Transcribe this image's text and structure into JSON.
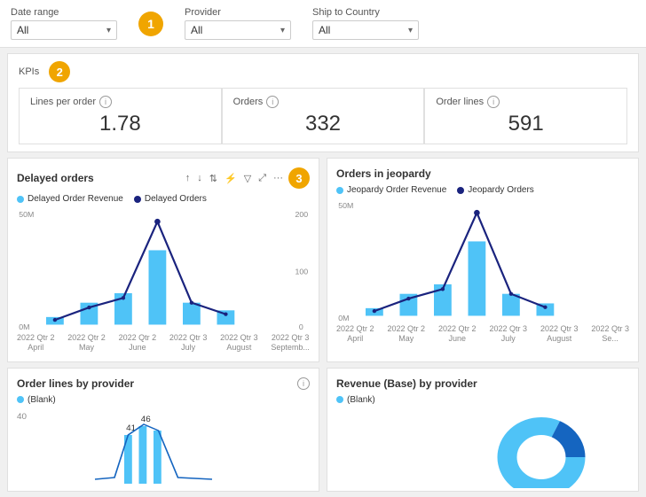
{
  "filters": {
    "date_range": {
      "label": "Date range",
      "value": "All"
    },
    "provider": {
      "label": "Provider",
      "value": "All"
    },
    "ship_to_country": {
      "label": "Ship to Country",
      "value": "All"
    }
  },
  "badges": {
    "badge1": "1",
    "badge2": "2",
    "badge3": "3"
  },
  "kpis": {
    "section_label": "KPIs",
    "cards": [
      {
        "title": "Lines per order",
        "value": "1.78"
      },
      {
        "title": "Orders",
        "value": "332"
      },
      {
        "title": "Order lines",
        "value": "591"
      }
    ]
  },
  "charts": {
    "delayed_orders": {
      "title": "Delayed orders",
      "legend": [
        {
          "label": "Delayed Order Revenue",
          "color": "#4fc3f7"
        },
        {
          "label": "Delayed Orders",
          "color": "#1a237e"
        }
      ],
      "y_left_max": "50M",
      "y_left_min": "0M",
      "y_right_max": "200",
      "y_right_mid": "100",
      "y_right_min": "0",
      "x_labels": [
        {
          "line1": "2022 Qtr 2",
          "line2": "April"
        },
        {
          "line1": "2022 Qtr 2",
          "line2": "May"
        },
        {
          "line1": "2022 Qtr 2",
          "line2": "June"
        },
        {
          "line1": "2022 Qtr 3",
          "line2": "July"
        },
        {
          "line1": "2022 Qtr 3",
          "line2": "August"
        },
        {
          "line1": "2022 Qtr 3",
          "line2": "Septemb..."
        }
      ]
    },
    "orders_in_jeopardy": {
      "title": "Orders in jeopardy",
      "legend": [
        {
          "label": "Jeopardy Order Revenue",
          "color": "#4fc3f7"
        },
        {
          "label": "Jeopardy Orders",
          "color": "#1a237e"
        }
      ],
      "y_left_max": "50M",
      "y_left_min": "0M",
      "x_labels": [
        {
          "line1": "2022 Qtr 2",
          "line2": "April"
        },
        {
          "line1": "2022 Qtr 2",
          "line2": "May"
        },
        {
          "line1": "2022 Qtr 2",
          "line2": "June"
        },
        {
          "line1": "2022 Qtr 3",
          "line2": "July"
        },
        {
          "line1": "2022 Qtr 3",
          "line2": "August"
        },
        {
          "line1": "2022 Qtr 3",
          "line2": "Se..."
        }
      ]
    },
    "order_lines_by_provider": {
      "title": "Order lines by provider",
      "legend": [
        {
          "label": "(Blank)",
          "color": "#4fc3f7"
        }
      ],
      "y_max": "40",
      "annotations": [
        "41",
        "46"
      ]
    },
    "revenue_by_provider": {
      "title": "Revenue (Base) by provider",
      "legend": [
        {
          "label": "(Blank)",
          "color": "#4fc3f7"
        }
      ]
    }
  },
  "controls": {
    "sort_asc": "↑",
    "sort_desc": "↓",
    "sort_double": "↕",
    "sort_branch": "⚡",
    "filter": "▽",
    "expand": "⤢",
    "more": "···"
  }
}
